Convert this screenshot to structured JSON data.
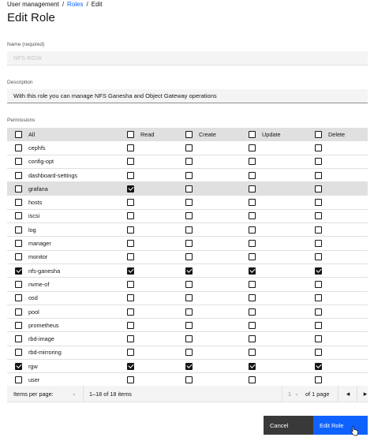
{
  "breadcrumb": {
    "item1": "User management",
    "item2": "Roles",
    "item3": "Edit",
    "separator": "/"
  },
  "page_title": "Edit Role",
  "name_field": {
    "label": "Name (required)",
    "value": "NFS-RGW"
  },
  "description_field": {
    "label": "Description",
    "value": "With this role you can manage NFS Ganesha and Object Gateway operations"
  },
  "permissions": {
    "label": "Permissions",
    "columns": {
      "all": "All",
      "read": "Read",
      "create": "Create",
      "update": "Update",
      "delete": "Delete"
    },
    "header_checked": {
      "all": false,
      "read": false,
      "create": false,
      "update": false,
      "delete": false
    },
    "rows": [
      {
        "name": "cephfs",
        "all": false,
        "read": false,
        "create": false,
        "update": false,
        "delete": false
      },
      {
        "name": "config-opt",
        "all": false,
        "read": false,
        "create": false,
        "update": false,
        "delete": false
      },
      {
        "name": "dashboard-settings",
        "all": false,
        "read": false,
        "create": false,
        "update": false,
        "delete": false
      },
      {
        "name": "grafana",
        "all": false,
        "read": true,
        "create": false,
        "update": false,
        "delete": false
      },
      {
        "name": "hosts",
        "all": false,
        "read": false,
        "create": false,
        "update": false,
        "delete": false
      },
      {
        "name": "iscsi",
        "all": false,
        "read": false,
        "create": false,
        "update": false,
        "delete": false
      },
      {
        "name": "log",
        "all": false,
        "read": false,
        "create": false,
        "update": false,
        "delete": false
      },
      {
        "name": "manager",
        "all": false,
        "read": false,
        "create": false,
        "update": false,
        "delete": false
      },
      {
        "name": "monitor",
        "all": false,
        "read": false,
        "create": false,
        "update": false,
        "delete": false
      },
      {
        "name": "nfs-ganesha",
        "all": true,
        "read": true,
        "create": true,
        "update": true,
        "delete": true
      },
      {
        "name": "nvme-of",
        "all": false,
        "read": false,
        "create": false,
        "update": false,
        "delete": false
      },
      {
        "name": "osd",
        "all": false,
        "read": false,
        "create": false,
        "update": false,
        "delete": false
      },
      {
        "name": "pool",
        "all": false,
        "read": false,
        "create": false,
        "update": false,
        "delete": false
      },
      {
        "name": "prometheus",
        "all": false,
        "read": false,
        "create": false,
        "update": false,
        "delete": false
      },
      {
        "name": "rbd-image",
        "all": false,
        "read": false,
        "create": false,
        "update": false,
        "delete": false
      },
      {
        "name": "rbd-mirroring",
        "all": false,
        "read": false,
        "create": false,
        "update": false,
        "delete": false
      },
      {
        "name": "rgw",
        "all": true,
        "read": true,
        "create": true,
        "update": true,
        "delete": true
      },
      {
        "name": "user",
        "all": false,
        "read": false,
        "create": false,
        "update": false,
        "delete": false
      }
    ]
  },
  "pagination": {
    "items_per_page_label": "Items per page:",
    "range_text": "1–18 of 18 items",
    "current_page": "1",
    "total_pages_text": "of 1 page",
    "prev_icon": "chevron-left-icon",
    "next_icon": "chevron-right-icon"
  },
  "buttons": {
    "cancel": "Cancel",
    "submit": "Edit Role"
  },
  "colors": {
    "primary": "#0f62fe",
    "secondary": "#393939",
    "field_bg": "#f4f4f4",
    "row_highlight": "#e0e0e0"
  }
}
